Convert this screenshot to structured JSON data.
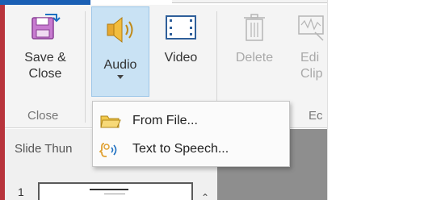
{
  "ribbon": {
    "save_close": {
      "label": "Save &\nClose"
    },
    "audio": {
      "label": "Audio"
    },
    "video": {
      "label": "Video"
    },
    "delete": {
      "label": "Delete"
    },
    "edit_clip": {
      "label": "Edi\nClip"
    },
    "groups": {
      "close": "Close",
      "edit": "Ec"
    }
  },
  "slides_pane": {
    "title": "Slide Thun",
    "slide_number": "1"
  },
  "audio_menu": {
    "items": [
      {
        "label": "From File...",
        "icon": "folder-icon"
      },
      {
        "label": "Text to Speech...",
        "icon": "speech-icon"
      }
    ]
  },
  "colors": {
    "accent_blue": "#1a5fb4",
    "pressed_bg": "#c9e2f4",
    "red_edge": "#b8343c"
  }
}
